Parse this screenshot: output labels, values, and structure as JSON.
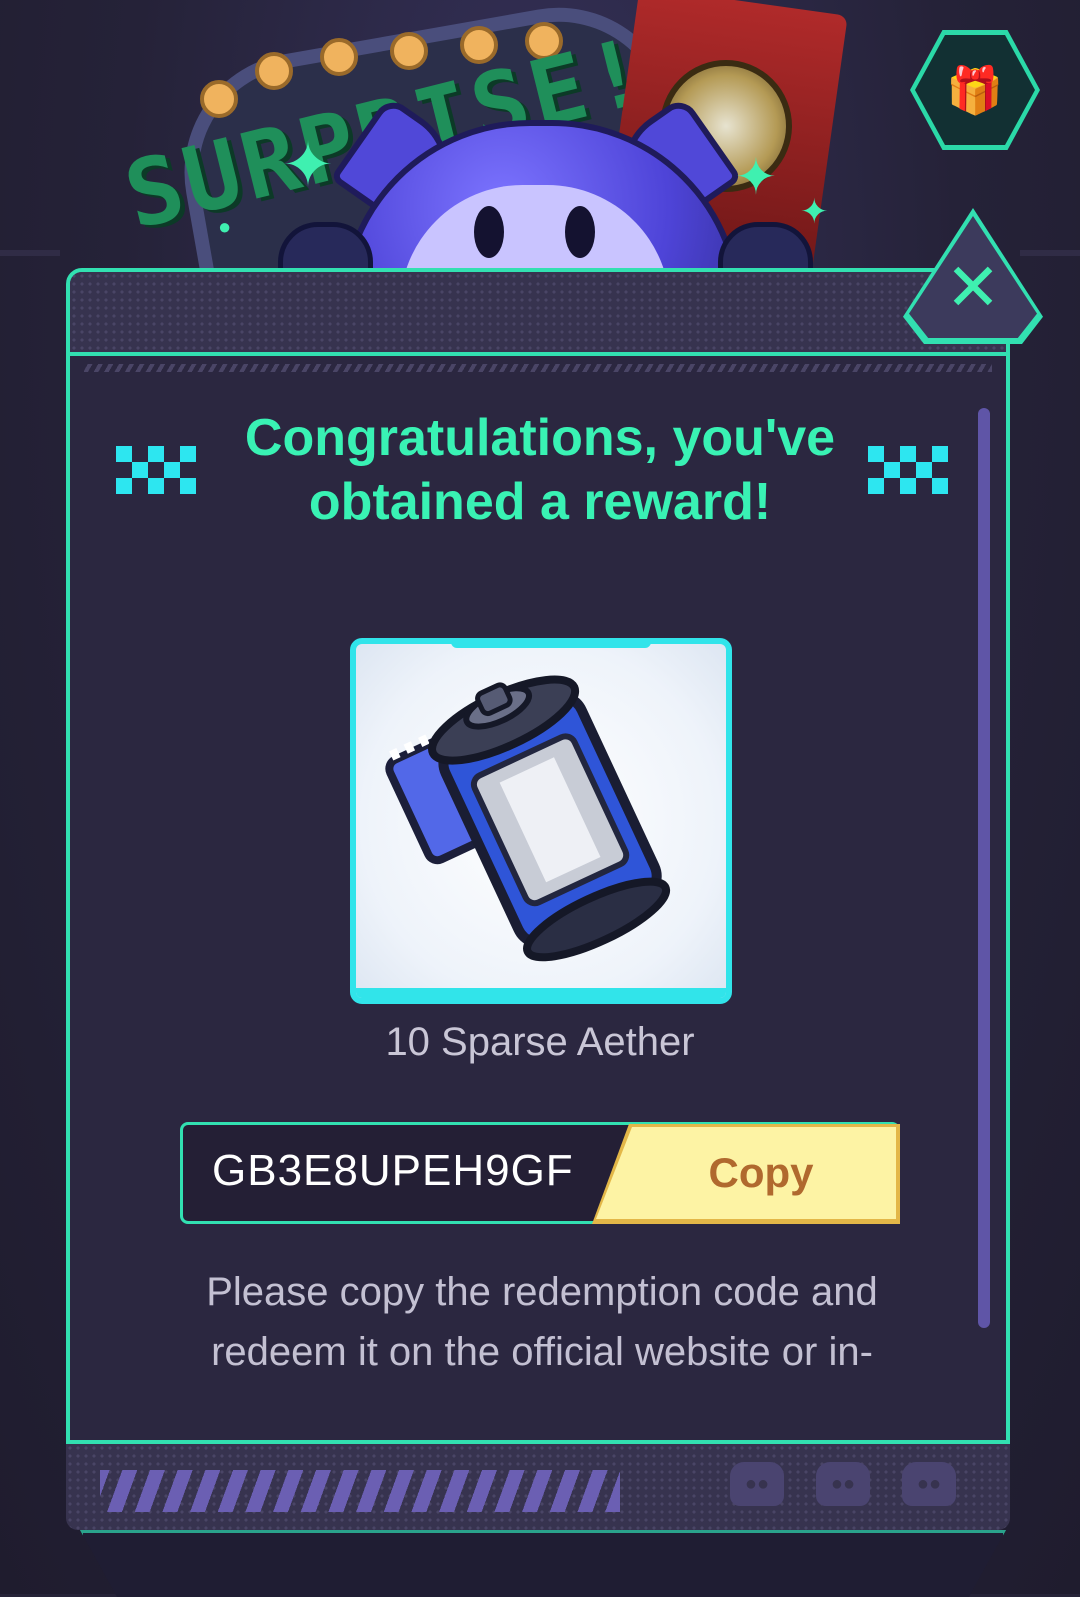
{
  "header": {
    "banner_text": "SURPRISE!",
    "gift_icon": "gift-icon"
  },
  "dialog": {
    "close_icon": "close-icon",
    "title": "Congratulations, you've obtained a reward!",
    "reward": {
      "image_icon": "film-canister-icon",
      "name": "10 Sparse Aether"
    },
    "code": {
      "value": "GB3E8UPEH9GF",
      "copy_label": "Copy"
    },
    "instructions": "Please copy the redemption code and redeem it on the official website or in-"
  },
  "colors": {
    "accent": "#32e0b1",
    "title": "#39f2b4",
    "copy_button": "#fdf3a4",
    "copy_text": "#b0692e",
    "background": "#2b2740"
  }
}
